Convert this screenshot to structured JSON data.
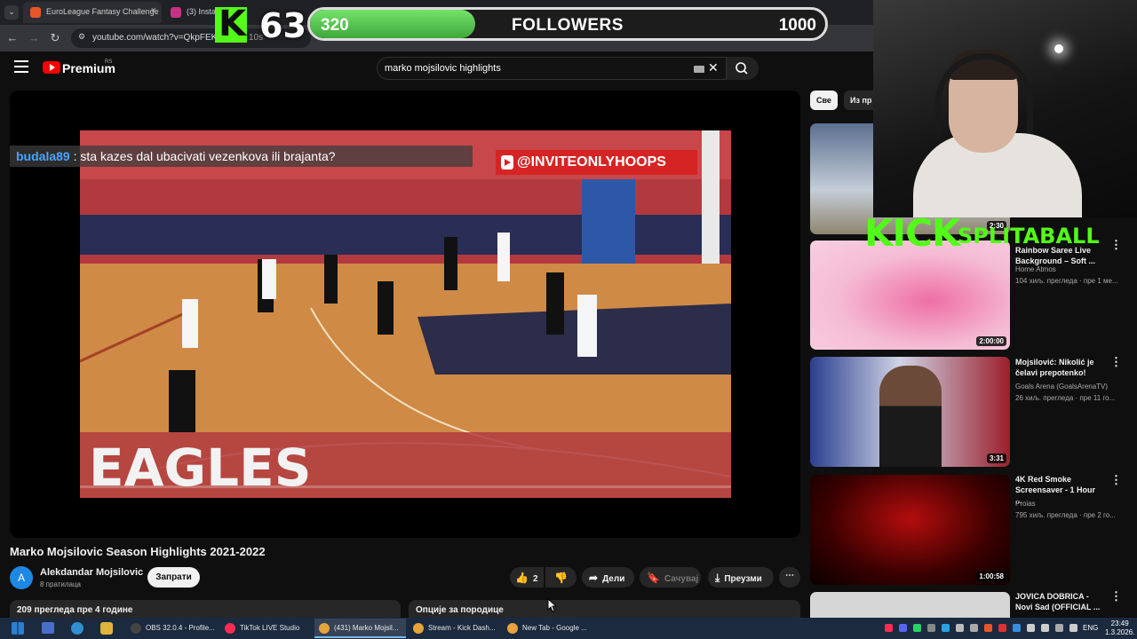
{
  "browser": {
    "tabs": [
      {
        "label": "EuroLeague Fantasy Challenge",
        "color": "#e8552b"
      },
      {
        "label": "(3) Instagr",
        "color": "#c13584"
      }
    ],
    "url": "youtube.com/watch?v=QkpFEKYc",
    "url_tail": "10s"
  },
  "overlay": {
    "kick_letter": "K",
    "kick_count": "63",
    "followers_current": "320",
    "followers_label": "FOLLOWERS",
    "followers_goal": "1000",
    "followers_progress": 0.32,
    "brand_text": "KICK",
    "brand_sub": "SPLITABALL"
  },
  "yt": {
    "brand": "Premium",
    "region": "RS",
    "search_value": "marko mojsilovic highlights",
    "chat_user": "budala89",
    "chat_message": " : sta kazes dal ubacivati vezenkova ili brajanta?",
    "watermark": "@INVITEONLYHOOPS",
    "video_title": "Marko Mojsilovic Season Highlights 2021-2022",
    "channel": "Alekdandar Mojsilovic",
    "channel_initial": "A",
    "subscribers": "8 пратилаца",
    "subscribe_label": "Запрати",
    "like_count": "2",
    "share_label": "Дели",
    "save_label": "Сачувај",
    "download_label": "Преузми",
    "views_date": "209 прегледа  пре 4 године",
    "family_label": "Опције за породице"
  },
  "chips": [
    "Све",
    "Из пр"
  ],
  "recommendations": [
    {
      "duration": "2:30",
      "title": "",
      "channel": "",
      "meta": ""
    },
    {
      "duration": "2:00:00",
      "title": "Rainbow Saree Live Background – Soft ...",
      "channel": "Home Atmos",
      "meta": "104 хиљ. прегледа · пре 1 ме..."
    },
    {
      "duration": "3:31",
      "title": "Mojsilović: Nikolić je čelavi prepotenko!",
      "channel": "Goals Arena (GoalsArenaTV)",
      "meta": "26 хиљ. прегледа · пре 11 го..."
    },
    {
      "duration": "1:00:58",
      "title": "4K Red Smoke Screensaver - 1 Hour ...",
      "channel": "Proias",
      "meta": "795 хиљ. прегледа · пре 2 го..."
    },
    {
      "duration": "",
      "title": "JOVICA DOBRICA - Novi Sad  (OFFICIAL ...",
      "channel": "",
      "meta": ""
    }
  ],
  "taskbar": {
    "apps": [
      {
        "label": "OBS 32.0.4 - Profile...",
        "color": "#444"
      },
      {
        "label": "TikTok LIVE Studio",
        "color": "#fe2c55"
      },
      {
        "label": "(431) Marko Mojsil...",
        "color": "#e8a33d"
      },
      {
        "label": "Stream - Kick Dash...",
        "color": "#e8a33d"
      },
      {
        "label": "New Tab - Google ...",
        "color": "#e8a33d"
      }
    ],
    "lang": "ENG",
    "time": "23:49",
    "date": "1.3.2026."
  }
}
